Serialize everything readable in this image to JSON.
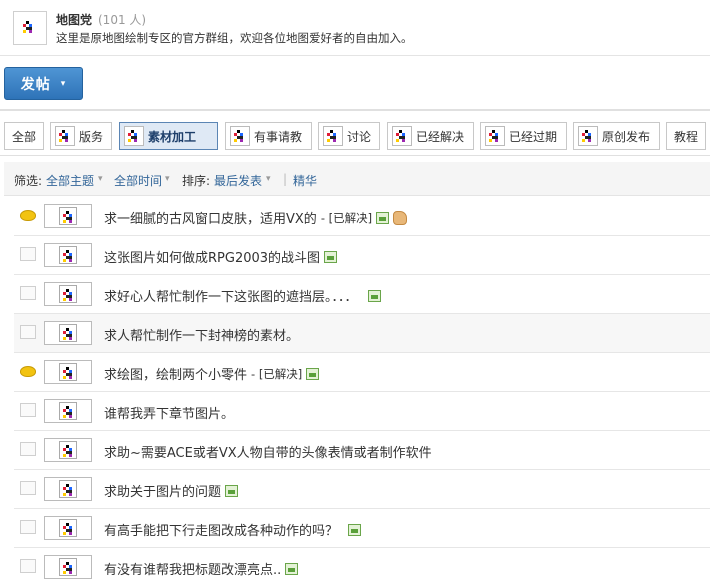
{
  "group": {
    "name": "地图党",
    "member_count": "(101 人)",
    "description": "这里是原地图绘制专区的官方群组，欢迎各位地图爱好者的自由加入。",
    "icon": "group-thumb-icon"
  },
  "toolbar": {
    "post_label": "发帖",
    "post_caret": "▾"
  },
  "tabs": [
    {
      "label": "全部",
      "icon": null,
      "active": false
    },
    {
      "label": "版务",
      "icon": "pixel-thumb-icon",
      "active": false
    },
    {
      "label": "素材加工",
      "icon": "pixel-thumb-icon",
      "active": true
    },
    {
      "label": "有事请教",
      "icon": "pixel-thumb-icon",
      "active": false
    },
    {
      "label": "讨论",
      "icon": "pixel-thumb-icon",
      "active": false
    },
    {
      "label": "已经解决",
      "icon": "pixel-thumb-icon",
      "active": false
    },
    {
      "label": "已经过期",
      "icon": "pixel-thumb-icon",
      "active": false
    },
    {
      "label": "原创发布",
      "icon": "pixel-thumb-icon",
      "active": false
    },
    {
      "label": "教程",
      "icon": null,
      "active": false
    }
  ],
  "filter": {
    "filter_label": "筛选:",
    "topic_value": "全部主题",
    "time_value": "全部时间",
    "sort_label": "排序:",
    "sort_value": "最后发表",
    "pipe": "|",
    "digest_label": "精华",
    "caret": "▾"
  },
  "threads": [
    {
      "title": "求一细腻的古风窗口皮肤，适用VX的",
      "solved": "- [已解决]",
      "status": "gold",
      "image": true,
      "thumbs_up": true,
      "shaded": false
    },
    {
      "title": "这张图片如何做成RPG2003的战斗图",
      "solved": "",
      "status": "doc",
      "image": true,
      "thumbs_up": false,
      "shaded": false
    },
    {
      "title": "求好心人帮忙制作一下这张图的遮挡层。．．．",
      "solved": "",
      "status": "doc",
      "image": true,
      "thumbs_up": false,
      "shaded": false
    },
    {
      "title": "求人帮忙制作一下封神榜的素材。",
      "solved": "",
      "status": "doc",
      "image": false,
      "thumbs_up": false,
      "shaded": true
    },
    {
      "title": "求绘图，绘制两个小零件",
      "solved": "- [已解决]",
      "status": "gold",
      "image": true,
      "thumbs_up": false,
      "shaded": false
    },
    {
      "title": "谁帮我弄下章节图片。",
      "solved": "",
      "status": "doc",
      "image": false,
      "thumbs_up": false,
      "shaded": false
    },
    {
      "title": "求助~需要ACE或者VX人物自带的头像表情或者制作软件",
      "solved": "",
      "status": "doc",
      "image": false,
      "thumbs_up": false,
      "shaded": false
    },
    {
      "title": "求助关于图片的问题",
      "solved": "",
      "status": "doc",
      "image": true,
      "thumbs_up": false,
      "shaded": false
    },
    {
      "title": "有高手能把下行走图改成各种动作的吗？",
      "solved": "",
      "status": "doc",
      "image": true,
      "thumbs_up": false,
      "shaded": false
    },
    {
      "title": "有没有谁帮我把标题改漂亮点..",
      "solved": "",
      "status": "doc",
      "image": true,
      "thumbs_up": false,
      "shaded": false
    }
  ],
  "colors": {
    "link": "#336699",
    "post_button": "#2e73b8",
    "active_tab": "#dfe9f5"
  }
}
